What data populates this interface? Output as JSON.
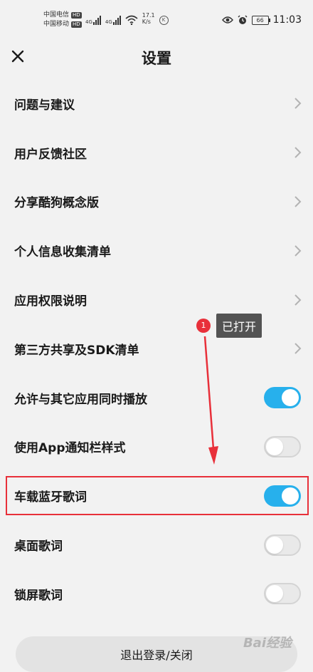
{
  "status_bar": {
    "carrier_1": "中国电信",
    "carrier_2": "中国移动",
    "hd_badge": "HD",
    "signal_label": "4G",
    "net_speed_value": "17.1",
    "net_speed_unit": "K/s",
    "k_icon_label": "K",
    "battery": "66",
    "time": "11:03"
  },
  "header": {
    "title": "设置"
  },
  "menu_items": [
    {
      "label": "问题与建议",
      "control": "chevron"
    },
    {
      "label": "用户反馈社区",
      "control": "chevron"
    },
    {
      "label": "分享酷狗概念版",
      "control": "chevron"
    },
    {
      "label": "个人信息收集清单",
      "control": "chevron"
    },
    {
      "label": "应用权限说明",
      "control": "chevron"
    },
    {
      "label": "第三方共享及SDK清单",
      "control": "chevron"
    },
    {
      "label": "允许与其它应用同时播放",
      "control": "toggle",
      "on": true
    },
    {
      "label": "使用App通知栏样式",
      "control": "toggle",
      "on": false
    },
    {
      "label": "车载蓝牙歌词",
      "control": "toggle",
      "on": true
    },
    {
      "label": "桌面歌词",
      "control": "toggle",
      "on": false
    },
    {
      "label": "锁屏歌词",
      "control": "toggle",
      "on": false
    }
  ],
  "annotation": {
    "badge": "1",
    "text": "已打开"
  },
  "logout_button": "退出登录/关闭",
  "watermark": "Bai经验",
  "colors": {
    "toggle_on": "#27b0ec",
    "toggle_off": "#e9e9e9",
    "highlight": "#e8303a"
  }
}
